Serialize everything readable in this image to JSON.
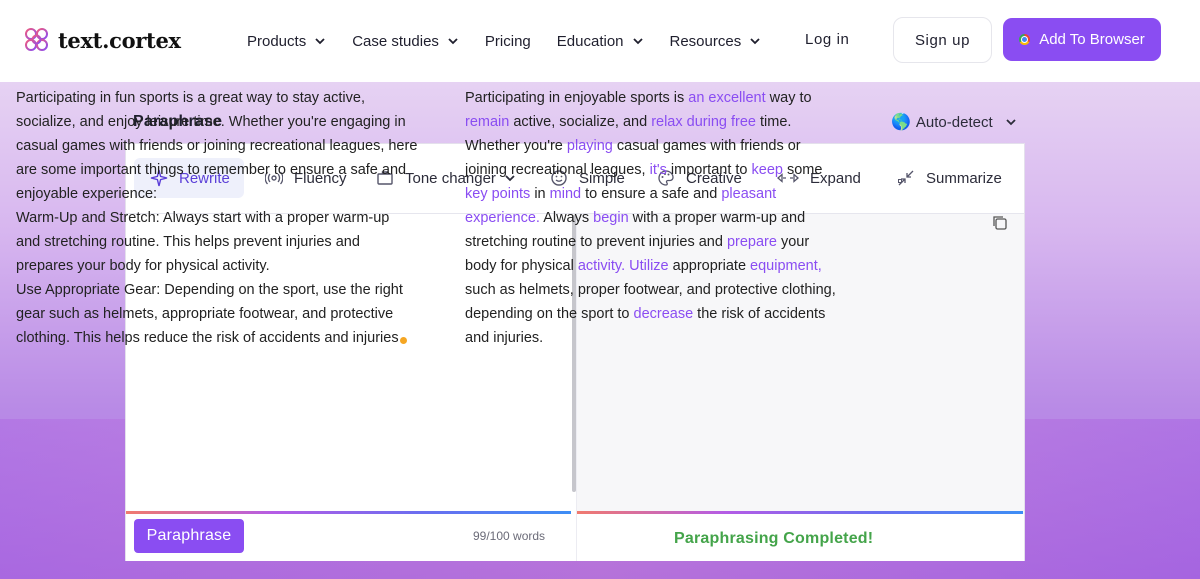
{
  "brand": {
    "name": "text.cortex"
  },
  "nav": {
    "items": [
      {
        "label": "Products",
        "dropdown": true
      },
      {
        "label": "Case studies",
        "dropdown": true
      },
      {
        "label": "Pricing",
        "dropdown": false
      },
      {
        "label": "Education",
        "dropdown": true
      },
      {
        "label": "Resources",
        "dropdown": true
      }
    ],
    "login": "Log in",
    "signup": "Sign up",
    "add_browser": "Add To Browser"
  },
  "tool": {
    "title": "Paraphrase",
    "language": "Auto-detect",
    "modes": [
      {
        "label": "Rewrite",
        "icon": "sparkle-icon",
        "active": true
      },
      {
        "label": "Fluency",
        "icon": "broadcast-icon",
        "active": false
      },
      {
        "label": "Tone changer",
        "icon": "briefcase-icon",
        "active": false,
        "dropdown": true
      },
      {
        "label": "Simple",
        "icon": "smile-icon",
        "active": false
      },
      {
        "label": "Creative",
        "icon": "palette-icon",
        "active": false
      },
      {
        "label": "Expand",
        "icon": "expand-arrows-icon",
        "active": false
      },
      {
        "label": "Summarize",
        "icon": "summarize-arrows-icon",
        "active": false
      }
    ],
    "input_lines": [
      "Participating in fun sports is a great way to stay active,",
      "socialize, and enjoy leisure time. Whether you're engaging in",
      "casual games with friends or joining recreational leagues, here",
      "are some important things to remember to ensure a safe and",
      "enjoyable experience:",
      "Warm-Up and Stretch: Always start with a proper warm-up",
      "and stretching routine. This helps prevent injuries and",
      "prepares your body for physical activity.",
      "Use Appropriate Gear: Depending on the sport, use the right",
      "gear such as helmets, appropriate footwear, and protective",
      "clothing. This helps reduce the risk of accidents and injuries"
    ],
    "output_lines": [
      [
        {
          "t": "Participating in enjoyable sports is "
        },
        {
          "t": "an excellent",
          "h": true
        },
        {
          "t": " way to"
        }
      ],
      [
        {
          "t": "remain",
          "h": true
        },
        {
          "t": " active, socialize, and "
        },
        {
          "t": "relax during free",
          "h": true
        },
        {
          "t": " time."
        }
      ],
      [
        {
          "t": "Whether you're "
        },
        {
          "t": "playing",
          "h": true
        },
        {
          "t": " casual games with friends or"
        }
      ],
      [
        {
          "t": "joining recreational leagues, "
        },
        {
          "t": "it's",
          "h": true
        },
        {
          "t": " important to "
        },
        {
          "t": "keep",
          "h": true
        },
        {
          "t": " some"
        }
      ],
      [
        {
          "t": "key points",
          "h": true
        },
        {
          "t": " in "
        },
        {
          "t": "mind",
          "h": true
        },
        {
          "t": " to ensure a safe and "
        },
        {
          "t": "pleasant",
          "h": true
        }
      ],
      [
        {
          "t": "experience.",
          "h": true
        },
        {
          "t": " Always "
        },
        {
          "t": "begin",
          "h": true
        },
        {
          "t": " with a proper warm-up and"
        }
      ],
      [
        {
          "t": "stretching routine to prevent injuries and "
        },
        {
          "t": "prepare",
          "h": true
        },
        {
          "t": " your"
        }
      ],
      [
        {
          "t": "body for physical "
        },
        {
          "t": "activity. Utilize",
          "h": true
        },
        {
          "t": " appropriate "
        },
        {
          "t": "equipment,",
          "h": true
        }
      ],
      [
        {
          "t": "such as helmets, proper footwear, and protective clothing,"
        }
      ],
      [
        {
          "t": "depending on the sport to "
        },
        {
          "t": "decrease",
          "h": true
        },
        {
          "t": " the risk of accidents"
        }
      ],
      [
        {
          "t": "and injuries."
        }
      ]
    ],
    "paraphrase_button": "Paraphrase",
    "word_count": "99/100 words",
    "status": "Paraphrasing Completed!"
  },
  "colors": {
    "accent": "#8a4df2",
    "highlight": "#8a4df2",
    "success": "#44a44a"
  }
}
